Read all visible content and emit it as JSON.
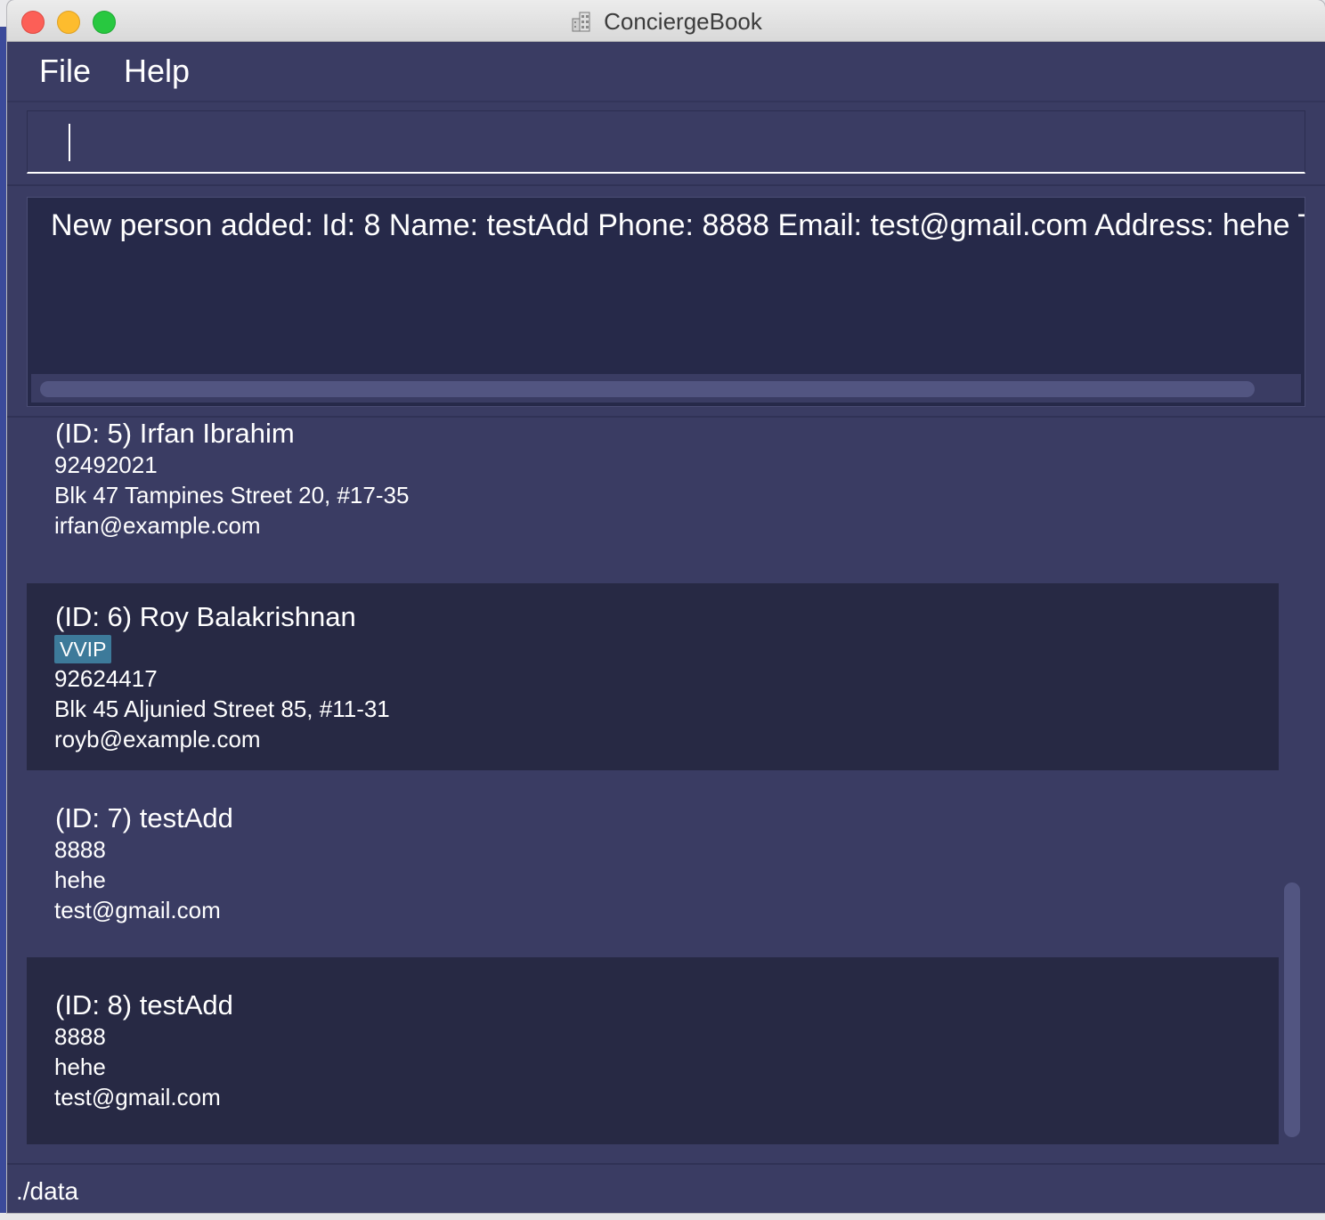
{
  "window": {
    "title": "ConciergeBook"
  },
  "menu": {
    "items": [
      "File",
      "Help"
    ]
  },
  "command_box": {
    "value": "",
    "placeholder": ""
  },
  "result_display": {
    "text": "New person added: Id: 8 Name: testAdd Phone: 8888 Email: test@gmail.com Address: hehe Tags"
  },
  "persons": [
    {
      "header": "(ID: 5) Irfan Ibrahim",
      "tags": [],
      "phone": "92492021",
      "address": "Blk 47 Tampines Street 20, #17-35",
      "email": "irfan@example.com"
    },
    {
      "header": "(ID: 6) Roy Balakrishnan",
      "tags": [
        "VVIP"
      ],
      "phone": "92624417",
      "address": "Blk 45 Aljunied Street 85, #11-31",
      "email": "royb@example.com"
    },
    {
      "header": "(ID: 7) testAdd",
      "tags": [],
      "phone": "8888",
      "address": "hehe",
      "email": "test@gmail.com"
    },
    {
      "header": "(ID: 8) testAdd",
      "tags": [],
      "phone": "8888",
      "address": "hehe",
      "email": "test@gmail.com"
    }
  ],
  "status_bar": {
    "path": "./data"
  },
  "colors": {
    "background": "#3a3c63",
    "dark_panel": "#262949",
    "card_dark": "#272944",
    "tag": "#3d7a9a",
    "scroll_thumb": "#525581"
  }
}
